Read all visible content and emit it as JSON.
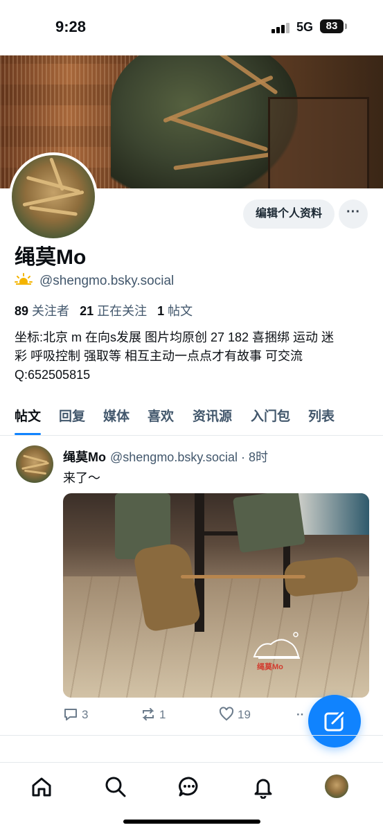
{
  "status_bar": {
    "time": "9:28",
    "network": "5G",
    "battery": "83"
  },
  "profile": {
    "display_name": "绳莫Mo",
    "handle": "@shengmo.bsky.social",
    "edit_button": "编辑个人资料",
    "more_button": "···",
    "stats": {
      "followers_count": "89",
      "followers_label": "关注者",
      "following_count": "21",
      "following_label": "正在关注",
      "posts_count": "1",
      "posts_label": "帖文"
    },
    "bio_lines": [
      "坐标:北京 m 在向s发展 图片均原创 27 182 喜捆绑 运动 迷",
      "彩 呼吸控制 强取等 相互主动一点点才有故事 可交流",
      "Q:652505815"
    ]
  },
  "tabs": [
    "帖文",
    "回复",
    "媒体",
    "喜欢",
    "资讯源",
    "入门包",
    "列表"
  ],
  "active_tab": "帖文",
  "post": {
    "author": "绳莫Mo",
    "handle": "@shengmo.bsky.social",
    "time": "· 8时",
    "text": "来了～",
    "watermark": "绳莫Mo",
    "replies": "3",
    "reposts": "1",
    "likes": "19",
    "more": "··"
  },
  "nav": [
    "home-icon",
    "search-icon",
    "chat-icon",
    "bell-icon",
    "profile-avatar"
  ],
  "colors": {
    "accent": "#1083fe",
    "muted": "#42576c",
    "button_bg": "#eef1f4"
  }
}
